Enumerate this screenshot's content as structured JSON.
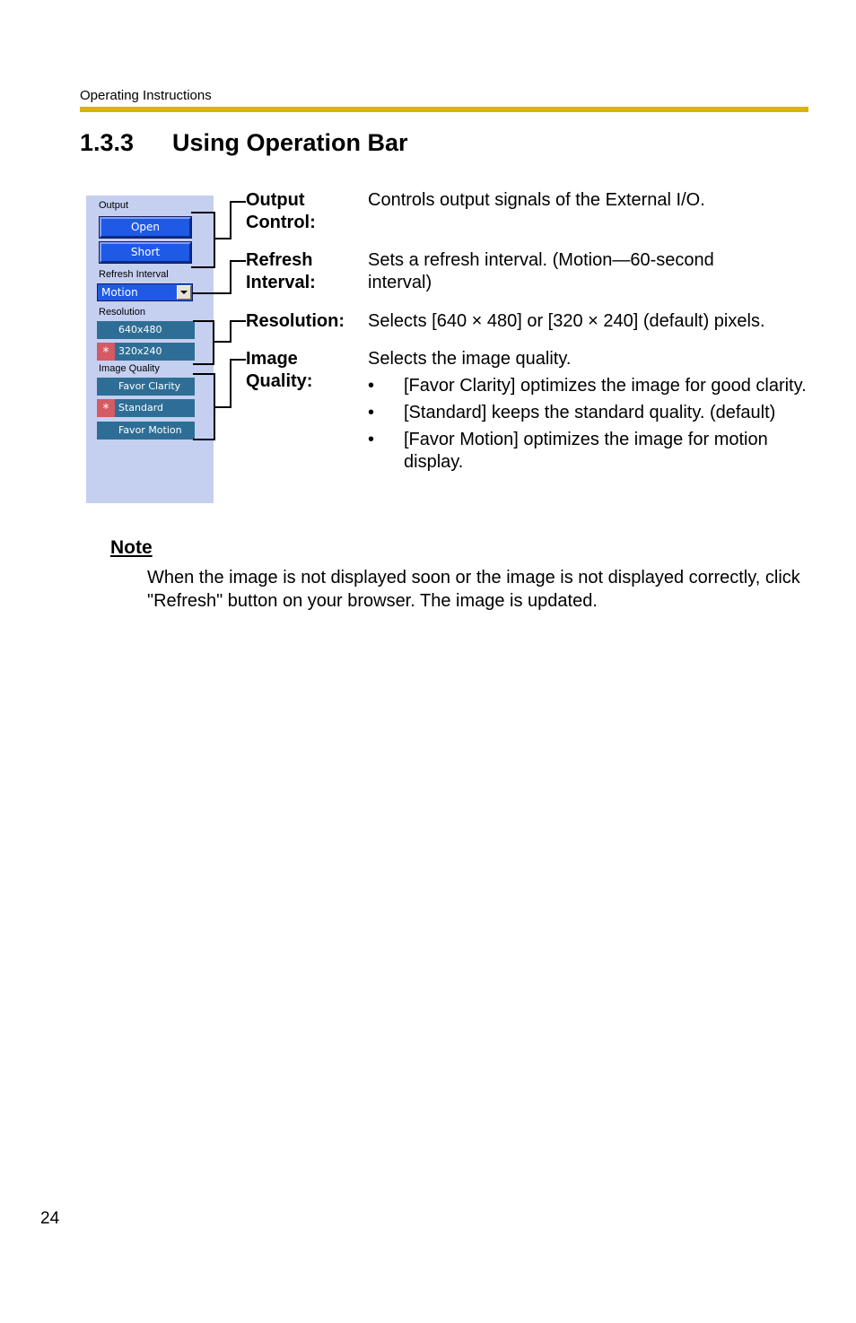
{
  "header": {
    "running_title": "Operating Instructions",
    "rule_color": "#d9b400"
  },
  "section": {
    "number": "1.3.3",
    "title": "Using Operation Bar"
  },
  "operation_bar": {
    "output_label": "Output",
    "output_buttons": [
      "Open",
      "Short"
    ],
    "refresh_label": "Refresh Interval",
    "refresh_selected": "Motion",
    "resolution_label": "Resolution",
    "resolution_options": [
      {
        "label": "640x480",
        "selected": false
      },
      {
        "label": "320x240",
        "selected": true
      }
    ],
    "quality_label": "Image Quality",
    "quality_options": [
      {
        "label": "Favor Clarity",
        "selected": false
      },
      {
        "label": "Standard",
        "selected": true
      },
      {
        "label": "Favor Motion",
        "selected": false
      }
    ],
    "selected_marker": "*",
    "colors": {
      "panel_bg": "#c5cff0",
      "blue_button": "#1e5ae6",
      "teal_button": "#2e6e96",
      "selected_marker": "#d45a64"
    }
  },
  "descriptions": [
    {
      "term_line1": "Output",
      "term_line2": "Control:",
      "text": "Controls output signals of the External I/O."
    },
    {
      "term_line1": "Refresh",
      "term_line2": "Interval:",
      "text": "Sets a refresh interval. (Motion—60-second interval)"
    },
    {
      "term_line1": "Resolution:",
      "term_line2": "",
      "text": "Selects [640 × 480] or [320 × 240] (default) pixels."
    },
    {
      "term_line1": "Image",
      "term_line2": "Quality:",
      "text": "Selects the image quality.",
      "bullets": [
        "[Favor Clarity] optimizes the image for good clarity.",
        "[Standard] keeps the standard quality. (default)",
        "[Favor Motion] optimizes the image for motion display."
      ],
      "bullet_glyph": "•"
    }
  ],
  "note": {
    "title": "Note",
    "body": "When the image is not displayed soon or the image is not displayed correctly, click \"Refresh\" button on your browser. The image is updated."
  },
  "footer": {
    "page_number": "24"
  }
}
